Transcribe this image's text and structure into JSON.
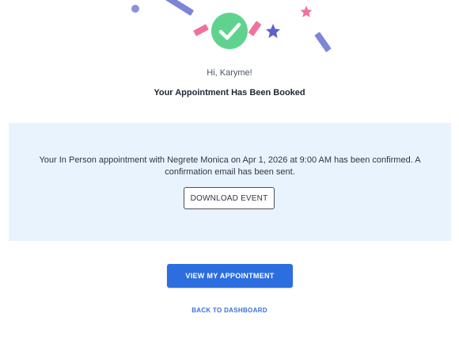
{
  "header": {
    "greeting": "Hi, Karyme!",
    "headline": "Your Appointment Has Been Booked",
    "success_icon": "check-circle-icon"
  },
  "colors": {
    "success_green": "#5fd38d",
    "accent_blue": "#2c6ee0",
    "panel_bg": "#e9f3fd",
    "confetti_pink": "#f0729c",
    "confetti_purple": "#7d86d6"
  },
  "confirmation": {
    "message": "Your In Person appointment with Negrete Monica on Apr 1, 2026 at 9:00 AM has been confirmed. A confirmation email has been sent.",
    "download_label": "DOWNLOAD EVENT"
  },
  "actions": {
    "view_label": "VIEW MY APPOINTMENT",
    "back_label": "BACK TO DASHBOARD"
  }
}
